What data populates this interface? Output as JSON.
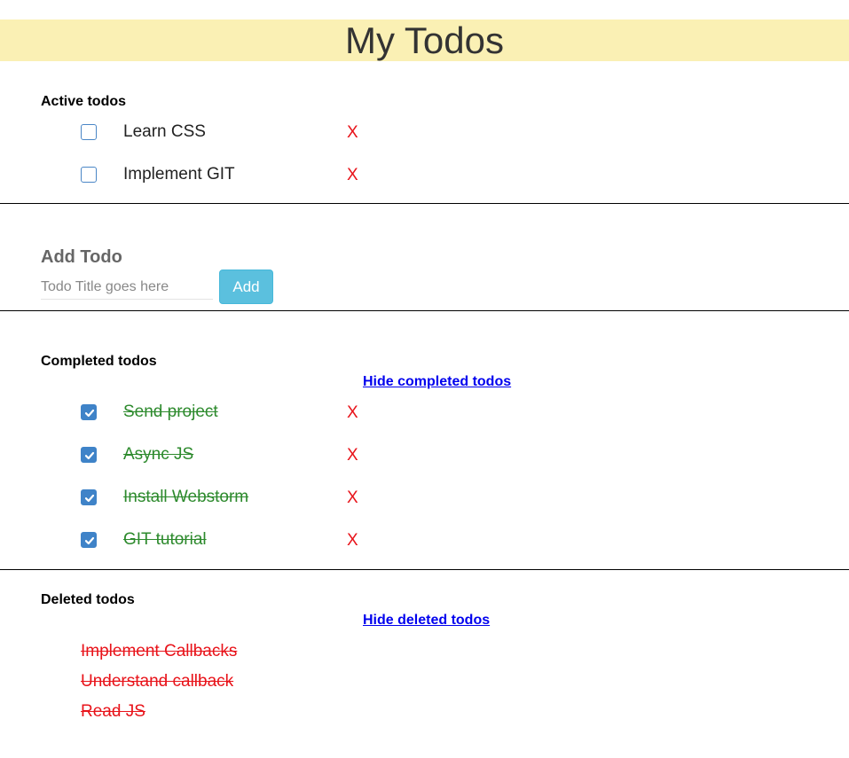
{
  "header": {
    "title": "My Todos"
  },
  "active": {
    "title": "Active todos",
    "items": [
      {
        "label": "Learn CSS",
        "delete": "X"
      },
      {
        "label": "Implement GIT",
        "delete": "X"
      }
    ]
  },
  "add": {
    "title": "Add Todo",
    "placeholder": "Todo Title goes here",
    "value": "",
    "button_label": "Add"
  },
  "completed": {
    "title": "Completed todos",
    "toggle_label": "Hide completed todos",
    "items": [
      {
        "label": "Send project",
        "delete": "X"
      },
      {
        "label": "Async JS",
        "delete": "X"
      },
      {
        "label": "Install Webstorm",
        "delete": "X"
      },
      {
        "label": "GIT tutorial",
        "delete": "X"
      }
    ]
  },
  "deleted": {
    "title": "Deleted todos",
    "toggle_label": "Hide deleted todos",
    "items": [
      {
        "label": "Implement Callbacks"
      },
      {
        "label": "Understand callback"
      },
      {
        "label": "Read JS"
      }
    ]
  },
  "colors": {
    "header_bg": "#faf0b4",
    "delete_red": "#e8131a",
    "completed_green": "#2d8a2d",
    "add_button": "#5bc0de",
    "checkbox_blue": "#3f83c8",
    "link_blue": "#0000ee"
  },
  "icons": {
    "checkbox_checked": "check-icon"
  }
}
